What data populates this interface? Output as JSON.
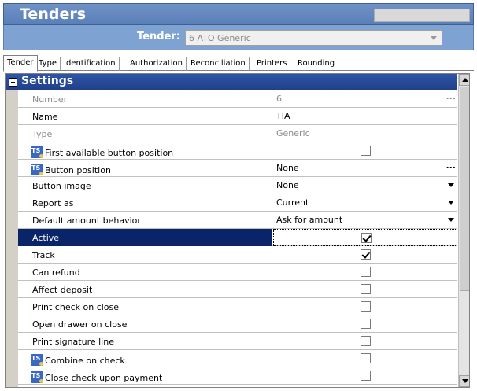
{
  "window": {
    "title": "Tenders"
  },
  "selector": {
    "label": "Tender:",
    "value": "6 ATO Generic"
  },
  "tabs": [
    {
      "label": "Tender",
      "active": true
    },
    {
      "label": "Type"
    },
    {
      "label": "Identification"
    },
    {
      "label": "Authorization"
    },
    {
      "label": "Reconciliation"
    },
    {
      "label": "Printers"
    },
    {
      "label": "Rounding"
    }
  ],
  "settings": {
    "header": "Settings",
    "rows": [
      {
        "name": "Number",
        "value": "6",
        "dim": true,
        "control": "ellipsis"
      },
      {
        "name": "Name",
        "value": "TIA"
      },
      {
        "name": "Type",
        "value": "Generic",
        "dim": true
      },
      {
        "name": "First available button position",
        "icon": "ts-icon",
        "control": "checkbox",
        "checked": false
      },
      {
        "name": "Button position",
        "value": "None",
        "icon": "ts-icon",
        "control": "ellipsis"
      },
      {
        "name": "Button image",
        "value": "None",
        "control": "dropdown",
        "underline": true
      },
      {
        "name": "Report as",
        "value": "Current",
        "control": "dropdown"
      },
      {
        "name": "Default amount behavior",
        "value": "Ask for amount",
        "control": "dropdown"
      },
      {
        "name": "Active",
        "control": "checkbox",
        "checked": true,
        "selected": true
      },
      {
        "name": "Track",
        "control": "checkbox",
        "checked": true
      },
      {
        "name": "Can refund",
        "control": "checkbox",
        "checked": false
      },
      {
        "name": "Affect deposit",
        "control": "checkbox",
        "checked": false
      },
      {
        "name": "Print check on close",
        "control": "checkbox",
        "checked": false
      },
      {
        "name": "Open drawer on close",
        "control": "checkbox",
        "checked": false
      },
      {
        "name": "Print signature line",
        "control": "checkbox",
        "checked": false
      },
      {
        "name": "Combine on check",
        "icon": "ts-icon",
        "control": "checkbox",
        "checked": false
      },
      {
        "name": "Close check upon payment",
        "icon": "ts-icon",
        "control": "checkbox",
        "checked": false
      }
    ]
  },
  "ellipsis_glyph": "...",
  "colors": {
    "title_bar": "#5a7fb8",
    "selector_bar": "#7ea3d3",
    "settings_header": "#1f3f8a",
    "selection": "#0a246a"
  }
}
